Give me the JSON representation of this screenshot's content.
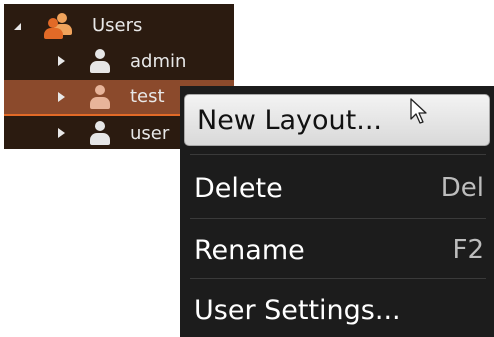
{
  "tree": {
    "root": {
      "label": "Users",
      "icon": "user-group-icon",
      "expanded": true
    },
    "children": [
      {
        "label": "admin",
        "icon": "user-icon",
        "selected": false
      },
      {
        "label": "test",
        "icon": "user-icon",
        "selected": true
      },
      {
        "label": "user",
        "icon": "user-icon",
        "selected": false
      }
    ]
  },
  "context_menu": {
    "items": [
      {
        "label": "New Layout...",
        "shortcut": "",
        "hovered": true
      },
      {
        "label": "Delete",
        "shortcut": "Del",
        "hovered": false
      },
      {
        "label": "Rename",
        "shortcut": "F2",
        "hovered": false
      },
      {
        "label": "User Settings...",
        "shortcut": "",
        "hovered": false
      }
    ]
  },
  "colors": {
    "tree_background": "#2b1b10",
    "selection": "#8b4a2c",
    "selection_accent": "#e26a27",
    "menu_background": "#1c1c1c",
    "menu_hover": "#e6e6e6"
  }
}
